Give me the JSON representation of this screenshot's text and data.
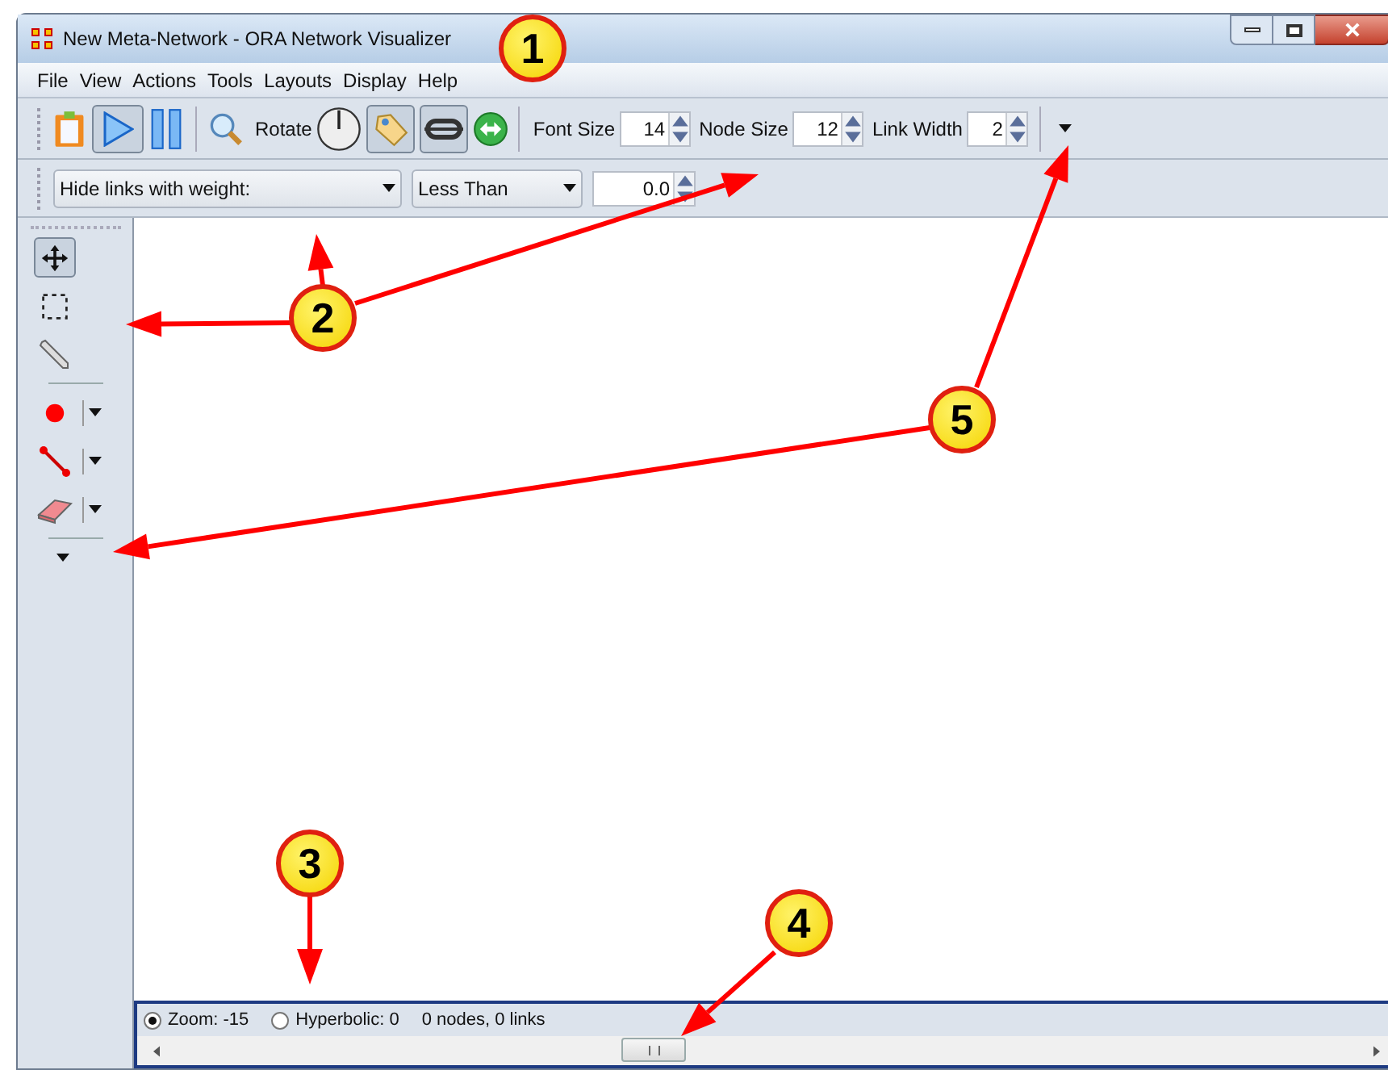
{
  "window": {
    "title": "New Meta-Network - ORA Network Visualizer"
  },
  "menu": [
    "File",
    "View",
    "Actions",
    "Tools",
    "Layouts",
    "Display",
    "Help"
  ],
  "toolbar": {
    "rotate_label": "Rotate",
    "play_selected": true,
    "tag_selected": true,
    "link_selected": true,
    "spinners": [
      {
        "label": "Font Size",
        "value": "14"
      },
      {
        "label": "Node Size",
        "value": "12"
      },
      {
        "label": "Link Width",
        "value": "2"
      }
    ]
  },
  "filter_bar": {
    "dropdowns": [
      {
        "value": "Hide links with weight:"
      },
      {
        "value": "Less Than"
      }
    ],
    "threshold": "0.0"
  },
  "tools": [
    {
      "kind": "move",
      "selected": true
    },
    {
      "kind": "select",
      "selected": false
    },
    {
      "kind": "pen",
      "selected": false
    },
    {
      "kind": "node",
      "selected": false
    },
    {
      "kind": "link",
      "selected": false
    },
    {
      "kind": "eraser",
      "selected": false
    }
  ],
  "status": {
    "options": [
      {
        "label": "Zoom: -15",
        "selected": true
      },
      {
        "label": "Hyperbolic: 0",
        "selected": false
      }
    ],
    "summary": "0 nodes, 0 links"
  },
  "callouts": [
    {
      "number": "1"
    },
    {
      "number": "2"
    },
    {
      "number": "3"
    },
    {
      "number": "4"
    },
    {
      "number": "5"
    }
  ]
}
